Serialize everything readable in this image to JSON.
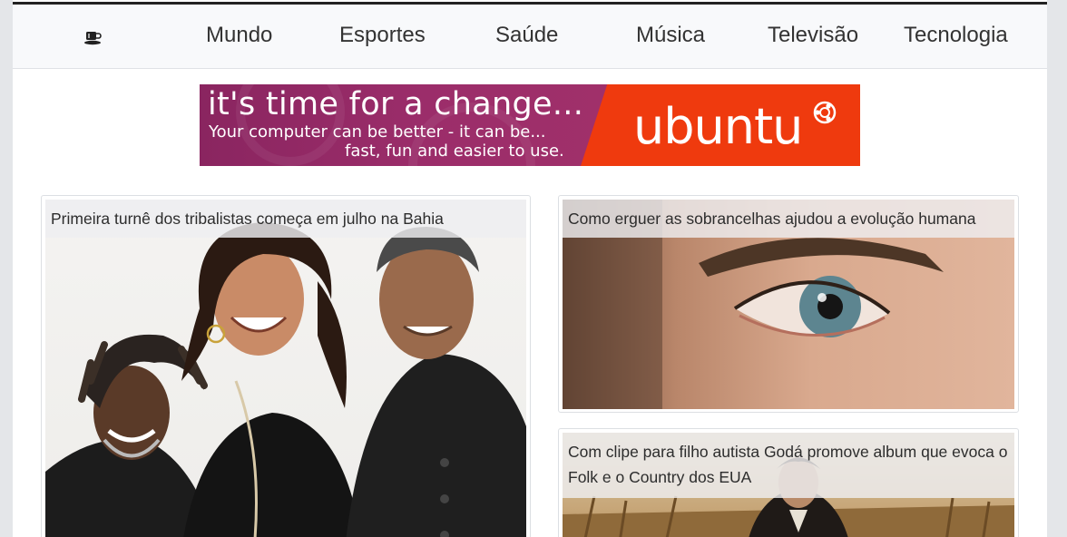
{
  "nav": {
    "logo_icon": "coffee-cup-icon",
    "items": [
      {
        "label": "Mundo"
      },
      {
        "label": "Esportes"
      },
      {
        "label": "Saúde"
      },
      {
        "label": "Música"
      },
      {
        "label": "Televisão"
      },
      {
        "label": "Tecnologia"
      }
    ]
  },
  "banner": {
    "line1": "it's time for a change...",
    "line2": "Your computer can be better - it can be...",
    "line3": "fast, fun and easier to use.",
    "brand": "ubuntu",
    "colors": {
      "purple": "#9b2d6a",
      "orange": "#ef3a0e"
    }
  },
  "articles": [
    {
      "title": "Primeira turnê dos tribalistas começa em julho na Bahia"
    },
    {
      "title": "Como erguer as sobrancelhas ajudou a evolução humana"
    },
    {
      "title": "Com clipe para filho autista Godá promove album que evoca o Folk e o Country dos EUA"
    }
  ]
}
